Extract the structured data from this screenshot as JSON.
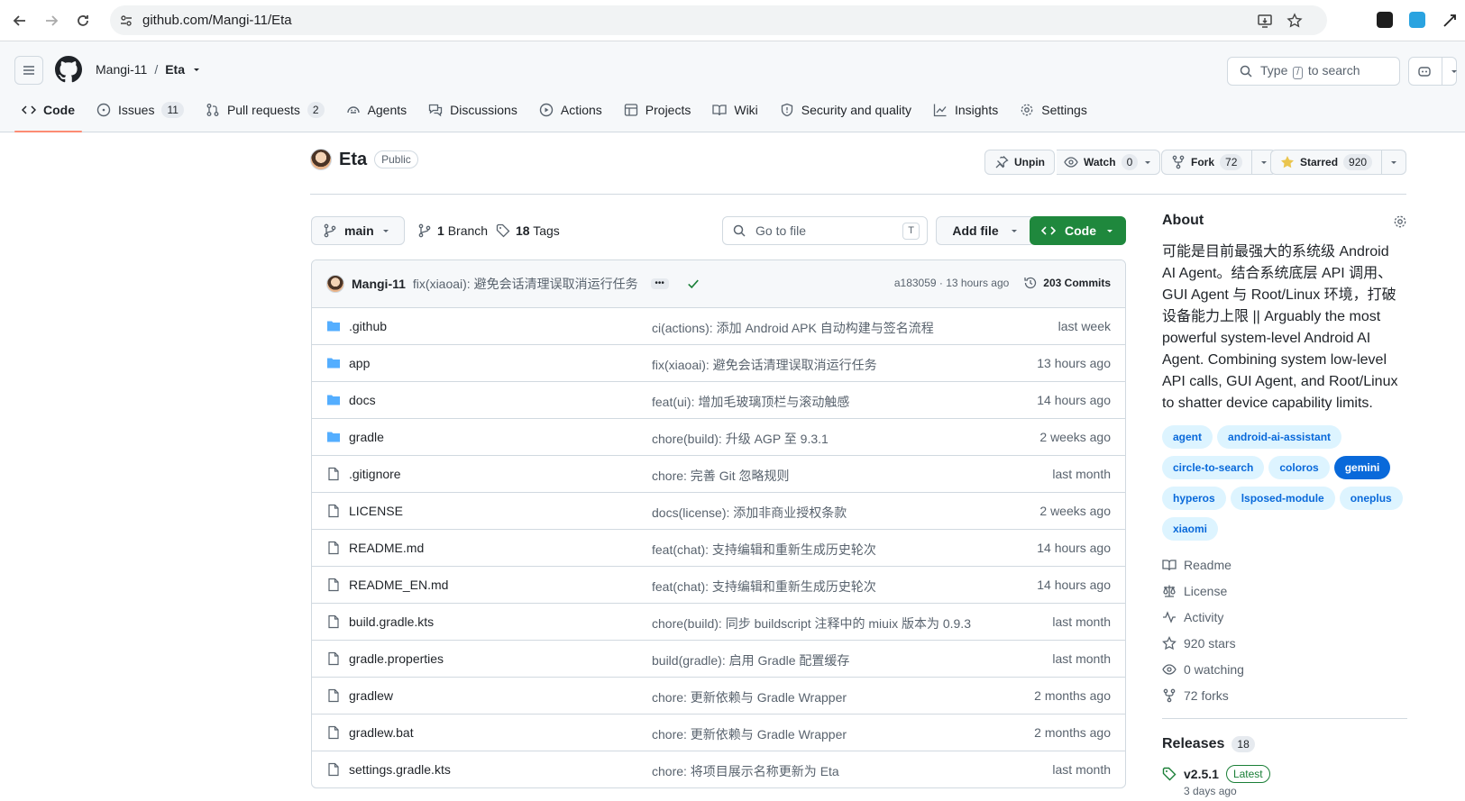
{
  "browser": {
    "url": "github.com/Mangi-11/Eta"
  },
  "header": {
    "owner": "Mangi-11",
    "repo": "Eta",
    "search_prefix": "Type",
    "search_key": "/",
    "search_suffix": "to search"
  },
  "tabs": [
    {
      "label": "Code",
      "count": ""
    },
    {
      "label": "Issues",
      "count": "11"
    },
    {
      "label": "Pull requests",
      "count": "2"
    },
    {
      "label": "Agents",
      "count": ""
    },
    {
      "label": "Discussions",
      "count": ""
    },
    {
      "label": "Actions",
      "count": ""
    },
    {
      "label": "Projects",
      "count": ""
    },
    {
      "label": "Wiki",
      "count": ""
    },
    {
      "label": "Security and quality",
      "count": ""
    },
    {
      "label": "Insights",
      "count": ""
    },
    {
      "label": "Settings",
      "count": ""
    }
  ],
  "repo_head": {
    "name": "Eta",
    "visibility": "Public",
    "unpin": "Unpin",
    "watch": "Watch",
    "watch_count": "0",
    "fork": "Fork",
    "fork_count": "72",
    "starred": "Starred",
    "star_count": "920"
  },
  "filenav": {
    "branch": "main",
    "branches_count": "1",
    "branches_label": "Branch",
    "tags_count": "18",
    "tags_label": "Tags",
    "goto_placeholder": "Go to file",
    "goto_key": "T",
    "add_file": "Add file",
    "code": "Code"
  },
  "latest_commit": {
    "author": "Mangi-11",
    "message": "fix(xiaoai): 避免会话清理误取消运行任务",
    "hash_time": "a183059 · 13 hours ago",
    "commits": "203 Commits"
  },
  "files": [
    {
      "type": "dir",
      "name": ".github",
      "message": "ci(actions): 添加 Android APK 自动构建与签名流程",
      "age": "last week"
    },
    {
      "type": "dir",
      "name": "app",
      "message": "fix(xiaoai): 避免会话清理误取消运行任务",
      "age": "13 hours ago"
    },
    {
      "type": "dir",
      "name": "docs",
      "message": "feat(ui): 增加毛玻璃顶栏与滚动触感",
      "age": "14 hours ago"
    },
    {
      "type": "dir",
      "name": "gradle",
      "message": "chore(build): 升级 AGP 至 9.3.1",
      "age": "2 weeks ago"
    },
    {
      "type": "file",
      "name": ".gitignore",
      "message": "chore: 完善 Git 忽略规则",
      "age": "last month"
    },
    {
      "type": "file",
      "name": "LICENSE",
      "message": "docs(license): 添加非商业授权条款",
      "age": "2 weeks ago"
    },
    {
      "type": "file",
      "name": "README.md",
      "message": "feat(chat): 支持编辑和重新生成历史轮次",
      "age": "14 hours ago"
    },
    {
      "type": "file",
      "name": "README_EN.md",
      "message": "feat(chat): 支持编辑和重新生成历史轮次",
      "age": "14 hours ago"
    },
    {
      "type": "file",
      "name": "build.gradle.kts",
      "message": "chore(build): 同步 buildscript 注释中的 miuix 版本为 0.9.3",
      "age": "last month"
    },
    {
      "type": "file",
      "name": "gradle.properties",
      "message": "build(gradle): 启用 Gradle 配置缓存",
      "age": "last month"
    },
    {
      "type": "file",
      "name": "gradlew",
      "message": "chore: 更新依赖与 Gradle Wrapper",
      "age": "2 months ago"
    },
    {
      "type": "file",
      "name": "gradlew.bat",
      "message": "chore: 更新依赖与 Gradle Wrapper",
      "age": "2 months ago"
    },
    {
      "type": "file",
      "name": "settings.gradle.kts",
      "message": "chore: 将项目展示名称更新为 Eta",
      "age": "last month"
    }
  ],
  "about": {
    "title": "About",
    "description_lines": [
      "可能是目前最强大的系统级 Android",
      "AI Agent。结合系统底层 API 调用、",
      "GUI Agent 与 Root/Linux 环境，打破",
      "设备能力上限 || Arguably the most",
      "powerful system-level Android AI",
      "Agent. Combining system low-level",
      "API calls, GUI Agent, and Root/Linux",
      "to shatter device capability limits."
    ],
    "topics": [
      "agent",
      "android-ai-assistant",
      "circle-to-search",
      "coloros",
      "gemini",
      "hyperos",
      "lsposed-module",
      "oneplus",
      "xiaomi"
    ],
    "active_topic": "gemini",
    "links": [
      {
        "icon": "book-icon",
        "label": "Readme"
      },
      {
        "icon": "law-icon",
        "label": "License"
      },
      {
        "icon": "pulse-icon",
        "label": "Activity"
      },
      {
        "icon": "star-icon",
        "label": "920 stars"
      },
      {
        "icon": "eye-icon",
        "label": "0 watching"
      },
      {
        "icon": "fork-icon",
        "label": "72 forks"
      }
    ]
  },
  "releases": {
    "title": "Releases",
    "count": "18",
    "latest_version": "v2.5.1",
    "latest_badge": "Latest",
    "latest_date": "3 days ago"
  }
}
